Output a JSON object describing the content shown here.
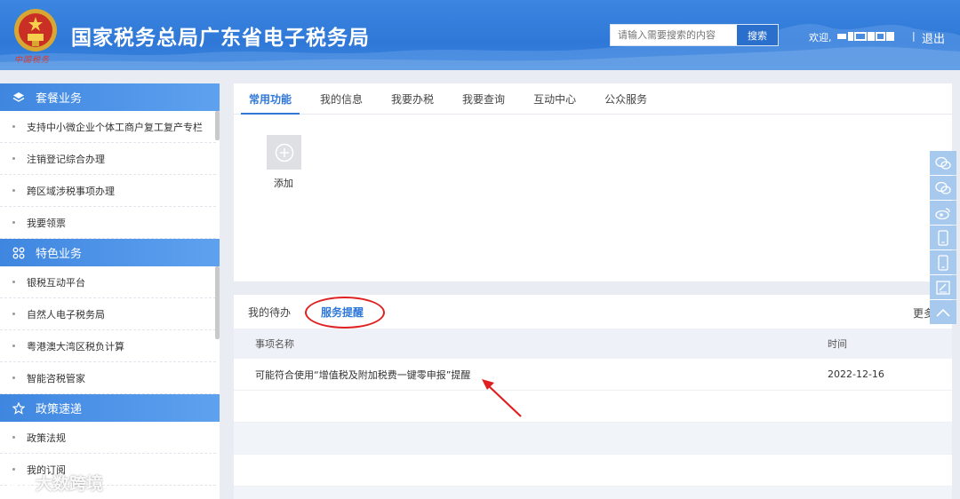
{
  "header": {
    "emblem_text": "中国税务",
    "title": "国家税务总局广东省电子税务局",
    "search_placeholder": "请输入需要搜索的内容",
    "search_button": "搜索",
    "welcome": "欢迎,",
    "separator": "|",
    "logout": "退出",
    "color_bg": "#2f78d8"
  },
  "sidebar": {
    "sections": [
      {
        "title": "套餐业务",
        "icon": "layers-icon",
        "items": [
          "支持中小微企业个体工商户复工复产专栏",
          "注销登记综合办理",
          "跨区域涉税事项办理",
          "我要领票"
        ]
      },
      {
        "title": "特色业务",
        "icon": "grid-icon",
        "items": [
          "银税互动平台",
          "自然人电子税务局",
          "粤港澳大湾区税负计算",
          "智能咨税管家"
        ]
      },
      {
        "title": "政策速递",
        "icon": "star-icon",
        "items": [
          "政策法规",
          "我的订阅"
        ]
      }
    ]
  },
  "main": {
    "tabs": [
      "常用功能",
      "我的信息",
      "我要办税",
      "我要查询",
      "互动中心",
      "公众服务"
    ],
    "add_label": "添加",
    "subtabs": [
      "我的待办",
      "服务提醒"
    ],
    "more": "更多",
    "columns": [
      "事项名称",
      "时间"
    ],
    "rows": [
      {
        "name": "可能符合使用“增值税及附加税费一键零申报”提醒",
        "date": "2022-12-16"
      }
    ]
  },
  "float_bar": [
    "wechat-icon",
    "wechat-icon",
    "weibo-icon",
    "mobile-icon",
    "mobile-icon",
    "edit-icon",
    "chevron-up-icon"
  ],
  "watermark": "大数跨境"
}
